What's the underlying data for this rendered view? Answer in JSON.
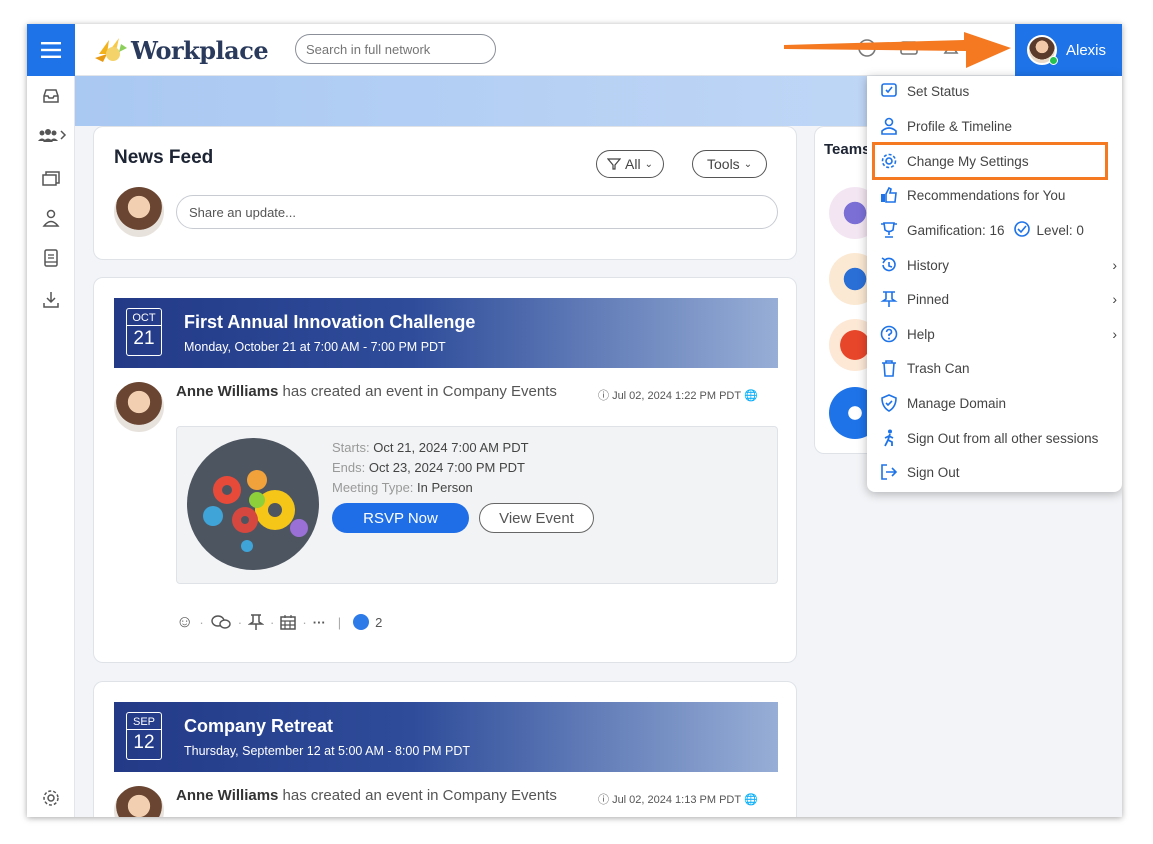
{
  "app": {
    "name": "Workplace"
  },
  "search": {
    "placeholder": "Search in full network"
  },
  "user": {
    "name": "Alexis"
  },
  "feed": {
    "title": "News Feed",
    "filter_label": "All",
    "tools_label": "Tools",
    "share_placeholder": "Share an update..."
  },
  "teams": {
    "title": "Teams"
  },
  "posts": [
    {
      "month": "OCT",
      "day": "21",
      "title": "First Annual Innovation Challenge",
      "subtitle": "Monday, October 21 at 7:00 AM - 7:00 PM PDT",
      "author": "Anne Williams",
      "action": " has created an event in Company Events",
      "timestamp": "Jul 02, 2024 1:22 PM PDT",
      "starts_label": "Starts:",
      "starts": "Oct 21, 2024 7:00 AM PDT",
      "ends_label": "Ends:",
      "ends": "Oct 23, 2024 7:00 PM PDT",
      "type_label": "Meeting Type:",
      "type": "In Person",
      "rsvp_label": "RSVP Now",
      "view_label": "View Event",
      "likes": "2"
    },
    {
      "month": "SEP",
      "day": "12",
      "title": "Company Retreat",
      "subtitle": "Thursday, September 12 at 5:00 AM - 8:00 PM PDT",
      "author": "Anne Williams",
      "action": " has created an event in Company Events",
      "timestamp": "Jul 02, 2024 1:13 PM PDT"
    }
  ],
  "menu": {
    "items": [
      {
        "label": "Set Status",
        "icon": "status-icon"
      },
      {
        "label": "Profile & Timeline",
        "icon": "person-icon"
      },
      {
        "label": "Change My Settings",
        "icon": "gear-icon"
      },
      {
        "label": "Recommendations for You",
        "icon": "thumbs-up-icon"
      },
      {
        "label": "Gamification: 16",
        "icon": "trophy-icon"
      },
      {
        "label": "History",
        "icon": "history-icon"
      },
      {
        "label": "Pinned",
        "icon": "pin-icon"
      },
      {
        "label": "Help",
        "icon": "help-icon"
      },
      {
        "label": "Trash Can",
        "icon": "trash-icon"
      },
      {
        "label": "Manage Domain",
        "icon": "shield-icon"
      },
      {
        "label": "Sign Out from all other sessions",
        "icon": "walking-icon"
      },
      {
        "label": "Sign Out",
        "icon": "sign-out-icon"
      }
    ],
    "level_label": "Level: 0"
  },
  "colors": {
    "accent": "#1e73e8",
    "highlight": "#f47920"
  }
}
